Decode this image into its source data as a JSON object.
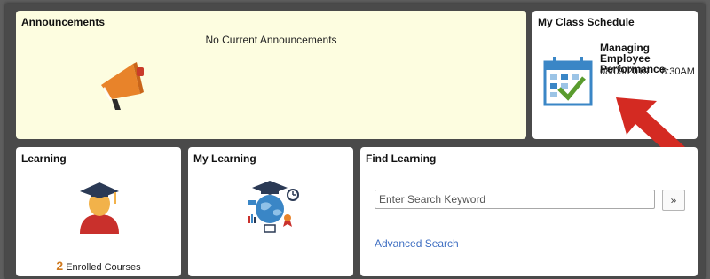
{
  "announcements": {
    "title": "Announcements",
    "message": "No Current Announcements",
    "icon": "megaphone-icon"
  },
  "class_schedule": {
    "title": "My Class Schedule",
    "course_name": "Managing Employee Performance",
    "date": "08/09/2019",
    "time": "8:30AM M",
    "icon": "calendar-check-icon"
  },
  "learning": {
    "title": "Learning",
    "enrolled_count": "2",
    "enrolled_label": "Enrolled Courses",
    "icon": "graduate-icon"
  },
  "my_learning": {
    "title": "My Learning",
    "icon": "learning-globe-icon"
  },
  "find_learning": {
    "title": "Find Learning",
    "search_placeholder": "Enter Search Keyword",
    "search_button": "»",
    "advanced_search": "Advanced Search"
  },
  "colors": {
    "announcement_bg": "#fdfde0",
    "megaphone": "#e8832a",
    "calendar_blue": "#3a86c6",
    "check_green": "#5a9c2e",
    "arrow_red": "#d42a22",
    "link_blue": "#3f6fc2",
    "count_orange": "#d07a1f"
  }
}
